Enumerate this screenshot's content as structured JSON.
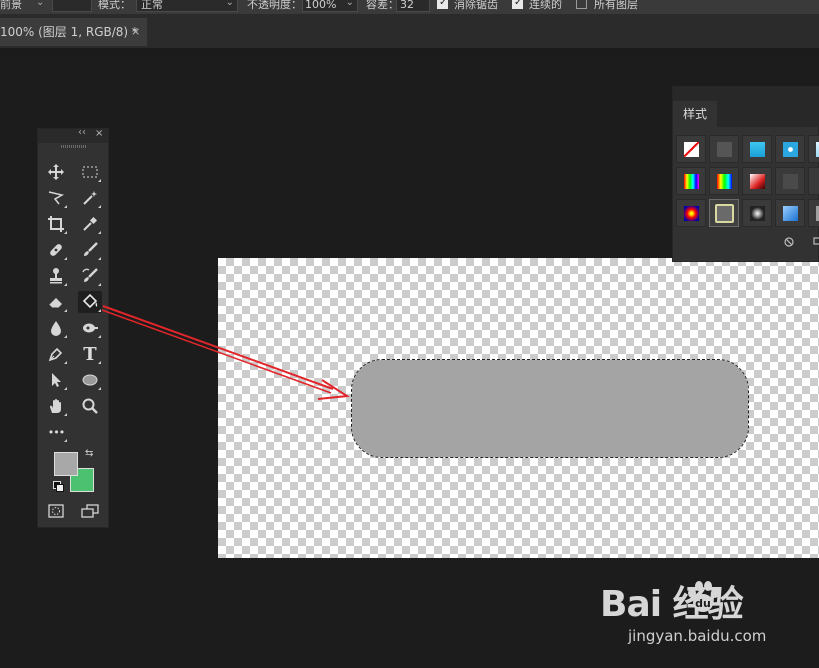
{
  "options_bar": {
    "fill_source": "前景",
    "mode_label": "模式：",
    "mode_value": "正常",
    "opacity_label": "不透明度：",
    "opacity_value": "100%",
    "tolerance_label": "容差：",
    "tolerance_value": "32",
    "antialias_label": "消除锯齿",
    "antialias_checked": true,
    "contiguous_label": "连续的",
    "contiguous_checked": true,
    "all_layers_label": "所有图层",
    "all_layers_checked": false
  },
  "document_tab": {
    "label": "100% (图层 1, RGB/8) *",
    "close_glyph": "×"
  },
  "tools_panel": {
    "collapse_glyph": "‹‹",
    "close_glyph": "×",
    "active_tool": "paint-bucket-tool",
    "type_tool_glyph": "T",
    "more_glyph": "•••",
    "foreground_color": "#a8a8a8",
    "background_color": "#4cc170"
  },
  "styles_panel": {
    "tab_label": "样式"
  },
  "colors": {
    "shape_fill": "#a4a4a4",
    "arrow": "#e0262a"
  },
  "watermark": {
    "logo_text": "Bai  经验",
    "url": "jingyan.baidu.com"
  }
}
